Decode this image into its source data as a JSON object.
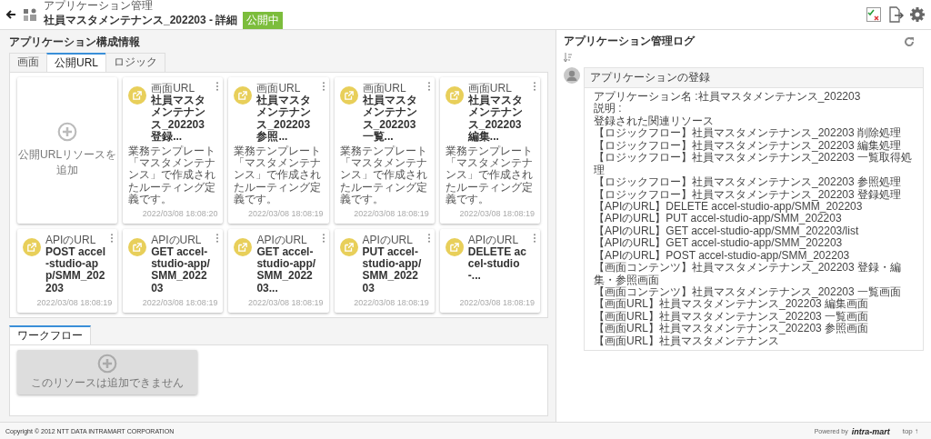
{
  "header": {
    "breadcrumb": "アプリケーション管理",
    "title": "社員マスタメンテナンス_202203 - 詳細",
    "status": "公開中"
  },
  "section_title": "アプリケーション構成情報",
  "tabs": [
    {
      "label": "画面",
      "selected": false
    },
    {
      "label": "公開URL",
      "selected": true
    },
    {
      "label": "ロジック",
      "selected": false
    }
  ],
  "add_card": {
    "label": "公開URLリソースを追加",
    "disabled": false
  },
  "cards": [
    {
      "type": "画面URL",
      "title": "社員マスタメンテナンス_202203 登録...",
      "description": "業務テンプレート「マスタメンテナンス」で作成されたルーティング定義です。",
      "date": "2022/03/08 18:08:20"
    },
    {
      "type": "画面URL",
      "title": "社員マスタメンテナンス_202203 参照...",
      "description": "業務テンプレート「マスタメンテナンス」で作成されたルーティング定義です。",
      "date": "2022/03/08 18:08:19"
    },
    {
      "type": "画面URL",
      "title": "社員マスタメンテナンス_202203 一覧...",
      "description": "業務テンプレート「マスタメンテナンス」で作成されたルーティング定義です。",
      "date": "2022/03/08 18:08:19"
    },
    {
      "type": "画面URL",
      "title": "社員マスタメンテナンス_202203 編集...",
      "description": "業務テンプレート「マスタメンテナンス」で作成されたルーティング定義です。",
      "date": "2022/03/08 18:08:19"
    },
    {
      "type": "APIのURL",
      "title": "POST accel-studio-app/SMM_202203",
      "date": "2022/03/08 18:08:19"
    },
    {
      "type": "APIのURL",
      "title": "GET accel-studio-app/SMM_202203",
      "date": "2022/03/08 18:08:19"
    },
    {
      "type": "APIのURL",
      "title": "GET accel-studio-app/SMM_202203...",
      "date": "2022/03/08 18:08:19"
    },
    {
      "type": "APIのURL",
      "title": "PUT accel-studio-app/SMM_202203",
      "date": "2022/03/08 18:08:19"
    },
    {
      "type": "APIのURL",
      "title": "DELETE accel-studio-...",
      "date": "2022/03/08 18:08:19"
    }
  ],
  "workflow": {
    "tabs": [
      {
        "label": "ワークフロー",
        "selected": true
      }
    ],
    "add_card": {
      "label": "このリソースは追加できません",
      "disabled": true
    }
  },
  "log": {
    "title": "アプリケーション管理ログ",
    "entries": [
      {
        "heading": "アプリケーションの登録",
        "lines": [
          "アプリケーション名 :社員マスタメンテナンス_202203",
          "説明 :",
          "登録された関連リソース",
          "【ロジックフロー】社員マスタメンテナンス_202203 削除処理",
          "【ロジックフロー】社員マスタメンテナンス_202203 編集処理",
          "【ロジックフロー】社員マスタメンテナンス_202203 一覧取得処理",
          "【ロジックフロー】社員マスタメンテナンス_202203 参照処理",
          "【ロジックフロー】社員マスタメンテナンス_202203 登録処理",
          "【APIのURL】DELETE accel-studio-app/SMM_202203",
          "【APIのURL】PUT accel-studio-app/SMM_202203",
          "【APIのURL】GET accel-studio-app/SMM_202203/list",
          "【APIのURL】GET accel-studio-app/SMM_202203",
          "【APIのURL】POST accel-studio-app/SMM_202203",
          "【画面コンテンツ】社員マスタメンテナンス_202203 登録・編集・参照画面",
          "【画面コンテンツ】社員マスタメンテナンス_202203 一覧画面",
          "【画面URL】社員マスタメンテナンス_202203 編集画面",
          "【画面URL】社員マスタメンテナンス_202203 一覧画面",
          "【画面URL】社員マスタメンテナンス_202203 参照画面",
          "【画面URL】社員マスタメンテナンス"
        ]
      }
    ]
  },
  "footer": {
    "copyright": "Copyright © 2012 NTT DATA INTRAMART CORPORATION",
    "powered_by": "Powered by",
    "logo": "intra-mart",
    "top_link": "top ↑"
  }
}
